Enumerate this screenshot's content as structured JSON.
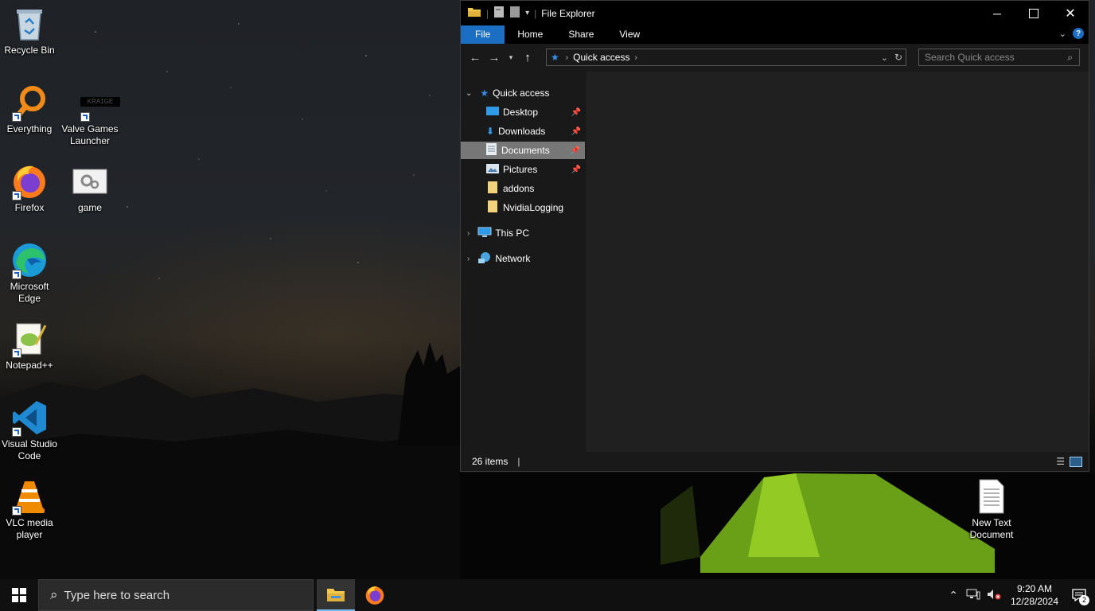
{
  "desktop": {
    "icons": [
      {
        "label": "Recycle Bin"
      },
      {
        "label": "Everything"
      },
      {
        "label": "Valve Games Launcher",
        "badge": "KRA1GE"
      },
      {
        "label": "Firefox"
      },
      {
        "label": "game"
      },
      {
        "label": "Microsoft Edge"
      },
      {
        "label": "Notepad++"
      },
      {
        "label": "Visual Studio Code"
      },
      {
        "label": "VLC media player"
      },
      {
        "label": "New Text Document"
      }
    ]
  },
  "explorer": {
    "title": "File Explorer",
    "ribbon_tabs": [
      "File",
      "Home",
      "Share",
      "View"
    ],
    "address": {
      "crumb": "Quick access"
    },
    "search_placeholder": "Search Quick access",
    "nav": {
      "quick_access": "Quick access",
      "items": [
        {
          "label": "Desktop",
          "icon": "desktop-icon",
          "pinned": true
        },
        {
          "label": "Downloads",
          "icon": "download-icon",
          "pinned": true
        },
        {
          "label": "Documents",
          "icon": "document-icon",
          "pinned": true,
          "selected": true
        },
        {
          "label": "Pictures",
          "icon": "pictures-icon",
          "pinned": true
        },
        {
          "label": "addons",
          "icon": "folder-icon",
          "pinned": false
        },
        {
          "label": "NvidiaLogging",
          "icon": "folder-icon",
          "pinned": false
        }
      ],
      "this_pc": "This PC",
      "network": "Network"
    },
    "status": {
      "item_count": "26 items"
    }
  },
  "taskbar": {
    "search_placeholder": "Type here to search",
    "clock_time": "9:20 AM",
    "clock_date": "12/28/2024",
    "notification_count": "2"
  },
  "colors": {
    "accent": "#1b6ec2",
    "selection": "#777777"
  }
}
